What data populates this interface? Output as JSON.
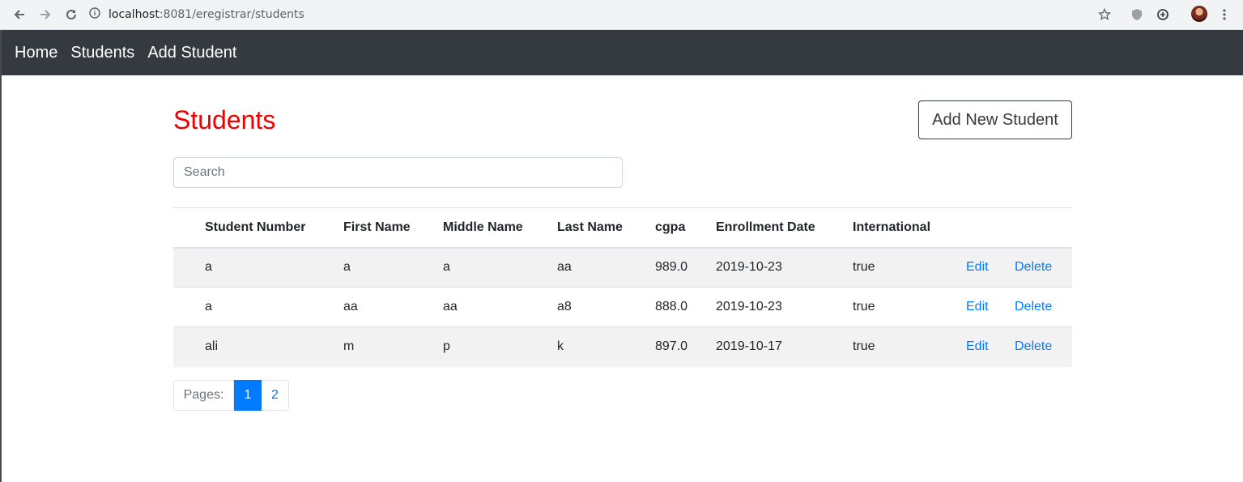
{
  "browser": {
    "url_host": "localhost",
    "url_rest": ":8081/eregistrar/students"
  },
  "nav": {
    "home": "Home",
    "students": "Students",
    "add_student": "Add Student"
  },
  "page": {
    "title": "Students",
    "add_button": "Add New Student"
  },
  "search": {
    "placeholder": "Search"
  },
  "table": {
    "headers": [
      "Student Number",
      "First Name",
      "Middle Name",
      "Last Name",
      "cgpa",
      "Enrollment Date",
      "International"
    ],
    "rows": [
      [
        "a",
        "a",
        "a",
        "aa",
        "989.0",
        "2019-10-23",
        "true"
      ],
      [
        "a",
        "aa",
        "aa",
        "a8",
        "888.0",
        "2019-10-23",
        "true"
      ],
      [
        "ali",
        "m",
        "p",
        "k",
        "897.0",
        "2019-10-17",
        "true"
      ]
    ],
    "edit_label": "Edit",
    "delete_label": "Delete"
  },
  "pagination": {
    "label": "Pages:",
    "pages": [
      "1",
      "2"
    ],
    "active": "1"
  },
  "colors": {
    "title": "#ee0000",
    "nav_bg": "#343a40",
    "link": "#007bff",
    "stripe": "#f2f2f2"
  }
}
